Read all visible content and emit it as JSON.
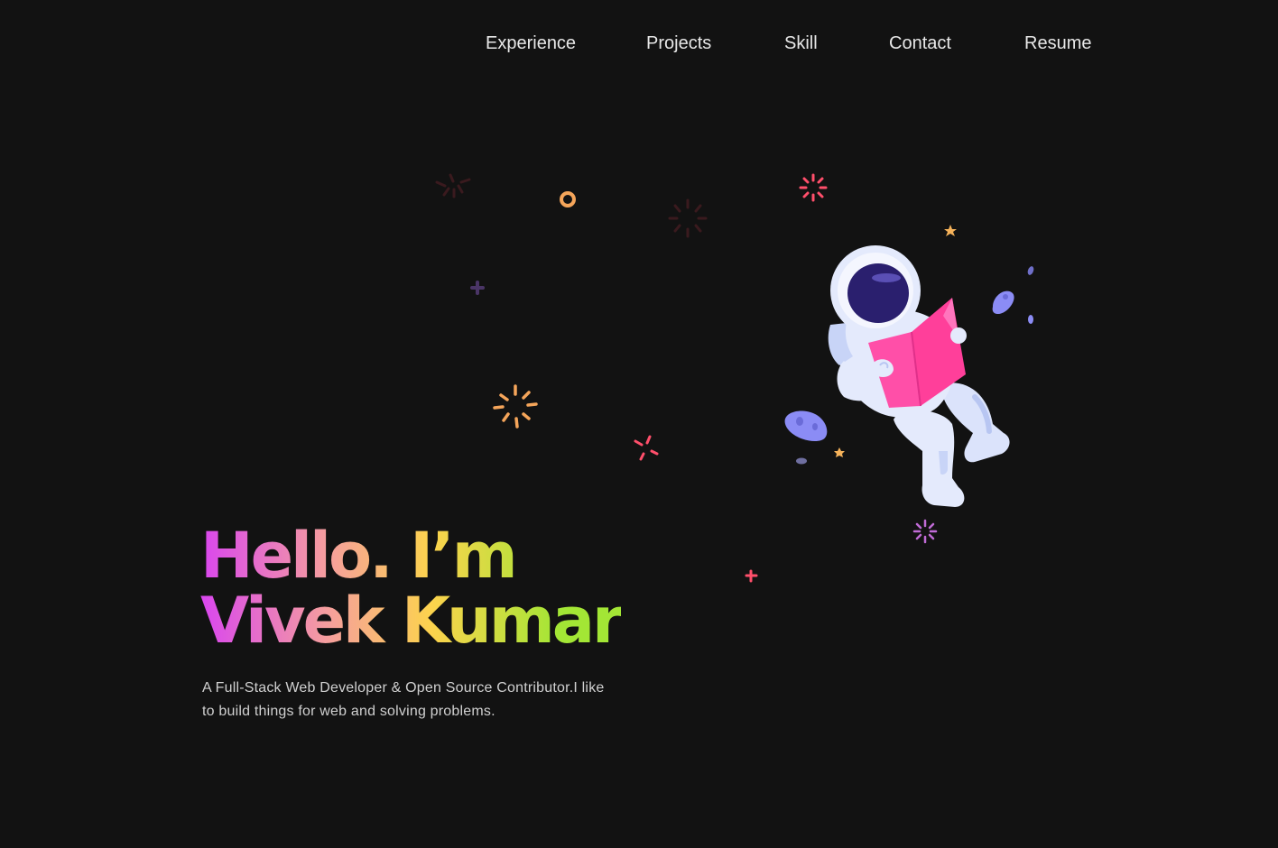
{
  "nav": {
    "items": [
      {
        "label": "Experience"
      },
      {
        "label": "Projects"
      },
      {
        "label": "Skill"
      },
      {
        "label": "Contact"
      },
      {
        "label": "Resume"
      }
    ]
  },
  "hero": {
    "greeting": "Hello. I’m",
    "name": "Vivek Kumar",
    "description": "A Full-Stack Web Developer & Open Source Contributor.I like to build things for web and solving problems."
  },
  "illustration": {
    "subject": "astronaut reading a book",
    "colors": {
      "suit": "#e4eafc",
      "visor": "#2a1f6e",
      "book": "#ff4fa8",
      "asteroid": "#8b8cf5",
      "sparkle_red": "#ff4f6b",
      "sparkle_orange": "#f5a55a",
      "sparkle_purple": "#c06bd6"
    }
  },
  "colors": {
    "background": "#121212",
    "nav_text": "#e8e8e8",
    "body_text": "#d0d0d0",
    "gradient": [
      "#d946ef",
      "#f59e9e",
      "#fcd34d",
      "#a3e635"
    ]
  }
}
